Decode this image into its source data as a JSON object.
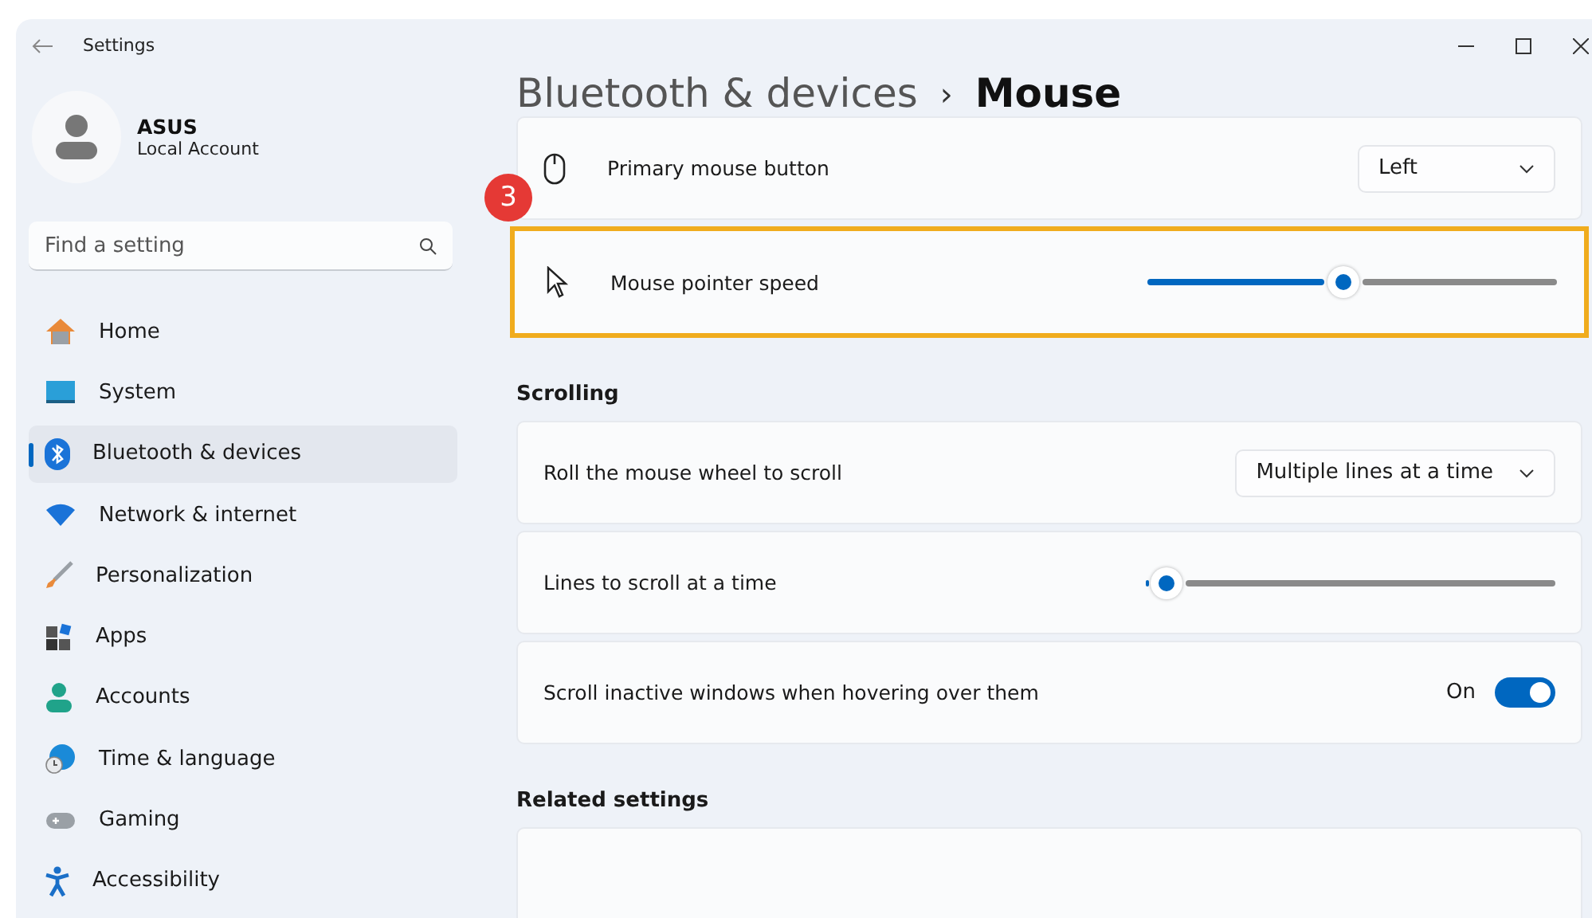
{
  "window": {
    "title": "Settings"
  },
  "account": {
    "name": "ASUS",
    "type": "Local Account"
  },
  "search": {
    "placeholder": "Find a setting"
  },
  "nav": [
    {
      "label": "Home",
      "selected": false
    },
    {
      "label": "System",
      "selected": false
    },
    {
      "label": "Bluetooth & devices",
      "selected": true
    },
    {
      "label": "Network & internet",
      "selected": false
    },
    {
      "label": "Personalization",
      "selected": false
    },
    {
      "label": "Apps",
      "selected": false
    },
    {
      "label": "Accounts",
      "selected": false
    },
    {
      "label": "Time & language",
      "selected": false
    },
    {
      "label": "Gaming",
      "selected": false
    },
    {
      "label": "Accessibility",
      "selected": false
    }
  ],
  "breadcrumb": {
    "parent": "Bluetooth & devices",
    "separator": "›",
    "current": "Mouse"
  },
  "sections": [
    {
      "rows": [
        {
          "kind": "dropdown",
          "label": "Primary mouse button",
          "value": "Left",
          "highlighted": false
        },
        {
          "kind": "slider",
          "label": "Mouse pointer speed",
          "level": 0.48,
          "highlighted": true,
          "badge": "3"
        }
      ]
    },
    {
      "heading": "Scrolling",
      "rows": [
        {
          "kind": "dropdown",
          "label": "Roll the mouse wheel to scroll",
          "value": "Multiple lines at a time",
          "highlighted": false
        },
        {
          "kind": "slider",
          "label": "Lines to scroll at a time",
          "level": 0.05,
          "highlighted": false
        },
        {
          "kind": "toggle",
          "label": "Scroll inactive windows when hovering over them",
          "state_label": "On",
          "on": true,
          "highlighted": false
        }
      ]
    },
    {
      "heading": "Related settings",
      "rows": [
        {
          "kind": "blank",
          "highlighted": false
        }
      ]
    }
  ]
}
